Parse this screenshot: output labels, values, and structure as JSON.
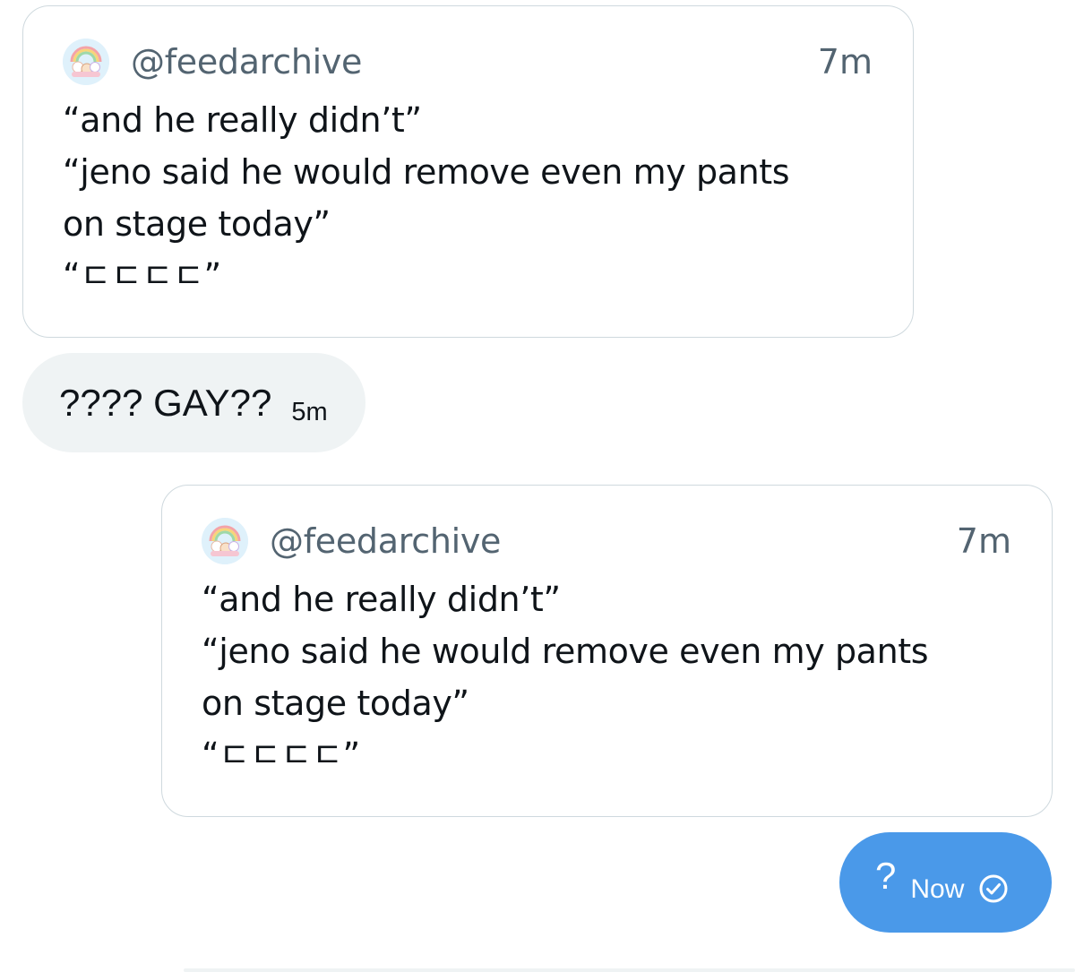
{
  "messages": [
    {
      "kind": "quote",
      "handle": "@feedarchive",
      "time": "7m",
      "lines": [
        "“and he really didn’t”",
        "“jeno said he would remove even my pants",
        "on stage today”",
        "“ㄷㄷㄷㄷ”"
      ]
    },
    {
      "kind": "received",
      "text": "???? GAY??",
      "time": "5m"
    },
    {
      "kind": "quote",
      "handle": "@feedarchive",
      "time": "7m",
      "lines": [
        "“and he really didn’t”",
        "“jeno said he would remove even my pants",
        "on stage today”",
        "“ㄷㄷㄷㄷ”"
      ]
    },
    {
      "kind": "sent",
      "text": "?",
      "time": "Now",
      "status_icon": "check-circle-icon"
    }
  ],
  "colors": {
    "sent_bubble": "#4a99e9",
    "received_bubble": "#eff3f4",
    "card_border": "#cfd9de",
    "secondary_text": "#536471"
  }
}
